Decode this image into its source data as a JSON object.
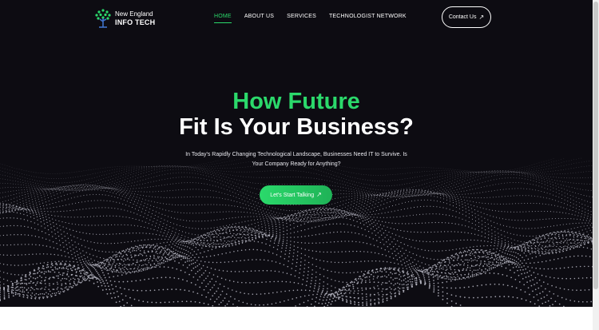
{
  "brand": {
    "line1": "New England",
    "line2": "INFO TECH",
    "icon": "tree-logo-icon",
    "accent": "#2bd96b"
  },
  "nav": {
    "items": [
      {
        "label": "HOME",
        "active": true
      },
      {
        "label": "ABOUT US",
        "active": false
      },
      {
        "label": "SERVICES",
        "active": false
      },
      {
        "label": "TECHNOLOGIST NETWORK",
        "active": false
      }
    ]
  },
  "contact": {
    "label": "Contact Us",
    "icon": "arrow-up-right-icon"
  },
  "hero": {
    "title_line1": "How Future",
    "title_line2": "Fit Is Your Business?",
    "subtitle": "In Today's Rapidly Changing Technological Landscape, Businesses Need IT to Survive. Is Your Company Ready for Anything?",
    "cta_label": "Let's Start Talking",
    "cta_icon": "arrow-up-right-icon",
    "background": "#0d0c12",
    "title_color": "#ffffff",
    "highlight_color": "#2bd96b"
  }
}
